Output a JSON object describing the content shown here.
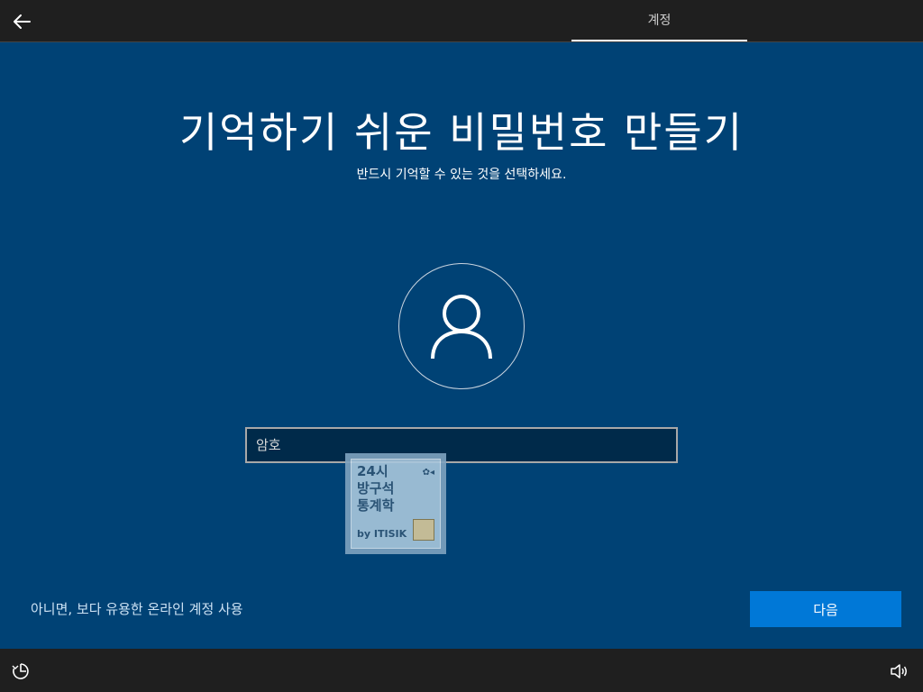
{
  "header": {
    "back_icon": "back-arrow-icon",
    "tab_label": "계정"
  },
  "main": {
    "title": "기억하기 쉬운 비밀번호 만들기",
    "subtitle": "반드시 기억할 수 있는 것을 선택하세요.",
    "avatar_icon": "user-icon",
    "password_placeholder": "암호",
    "password_value": "",
    "watermark_lines": [
      "24시",
      "방구석",
      "통계학"
    ],
    "watermark_by": "by ITISIK",
    "alt_link": "아니면, 보다 유용한 온라인 계정 사용",
    "next_button": "다음"
  },
  "footer": {
    "left_icon": "ease-of-access-icon",
    "right_icon": "volume-icon"
  },
  "colors": {
    "background": "#004275",
    "bar": "#1f1f1f",
    "accent": "#0078d7",
    "input_bg": "#002a4a"
  }
}
